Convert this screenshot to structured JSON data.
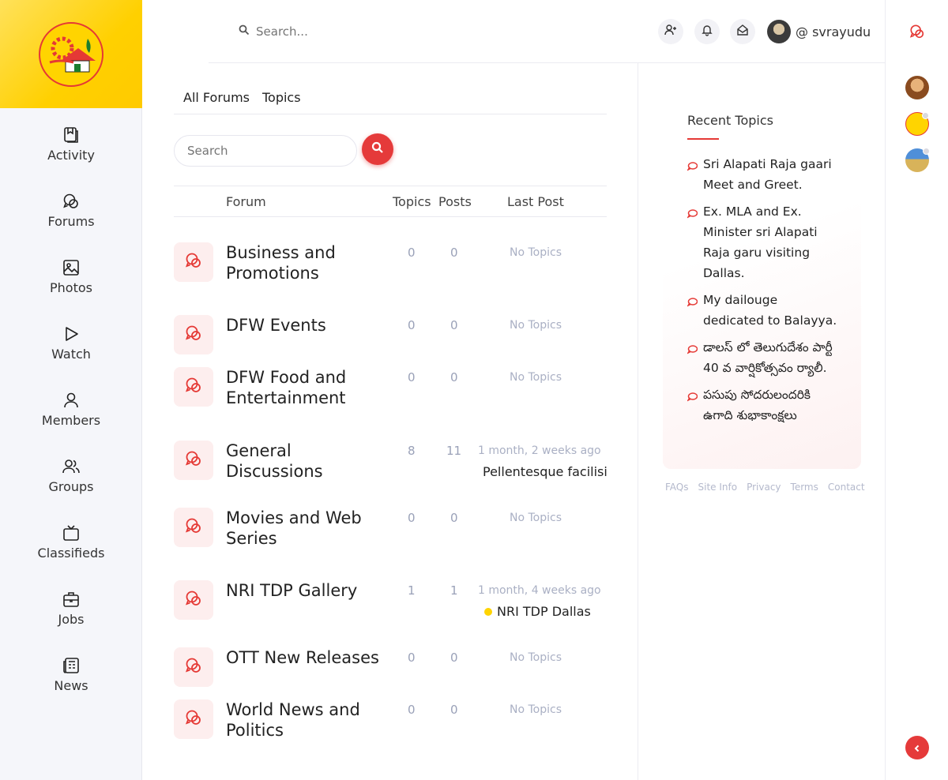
{
  "header": {
    "search_placeholder": "Search...",
    "username": "@ svrayudu"
  },
  "sidebar": {
    "items": [
      {
        "label": "Activity",
        "icon": "activity-icon"
      },
      {
        "label": "Forums",
        "icon": "forums-icon"
      },
      {
        "label": "Photos",
        "icon": "photos-icon"
      },
      {
        "label": "Watch",
        "icon": "watch-icon"
      },
      {
        "label": "Members",
        "icon": "members-icon"
      },
      {
        "label": "Groups",
        "icon": "groups-icon"
      },
      {
        "label": "Classifieds",
        "icon": "classifieds-icon"
      },
      {
        "label": "Jobs",
        "icon": "jobs-icon"
      },
      {
        "label": "News",
        "icon": "news-icon"
      }
    ]
  },
  "main": {
    "tabs": [
      "All Forums",
      "Topics"
    ],
    "search_placeholder": "Search",
    "columns": {
      "forum": "Forum",
      "topics": "Topics",
      "posts": "Posts",
      "last_post": "Last Post"
    },
    "forums": [
      {
        "name": "Business and Promotions",
        "topics": "0",
        "posts": "0",
        "last": "No Topics",
        "last_by": ""
      },
      {
        "name": "DFW Events",
        "topics": "0",
        "posts": "0",
        "last": "No Topics",
        "last_by": ""
      },
      {
        "name": "DFW Food and Entertainment",
        "topics": "0",
        "posts": "0",
        "last": "No Topics",
        "last_by": ""
      },
      {
        "name": "General Discussions",
        "topics": "8",
        "posts": "11",
        "last": "1 month, 2 weeks ago",
        "last_by": "Pellentesque facilisis"
      },
      {
        "name": "Movies and Web Series",
        "topics": "0",
        "posts": "0",
        "last": "No Topics",
        "last_by": ""
      },
      {
        "name": "NRI TDP Gallery",
        "topics": "1",
        "posts": "1",
        "last": "1 month, 4 weeks ago",
        "last_by": "NRI TDP Dallas"
      },
      {
        "name": "OTT New Releases",
        "topics": "0",
        "posts": "0",
        "last": "No Topics",
        "last_by": ""
      },
      {
        "name": "World News and Politics",
        "topics": "0",
        "posts": "0",
        "last": "No Topics",
        "last_by": ""
      }
    ]
  },
  "widget": {
    "title": "Recent Topics",
    "topics": [
      "Sri Alapati Raja gaari Meet and Greet.",
      "Ex. MLA and Ex. Minister sri Alapati Raja garu visiting Dallas.",
      "My dailouge dedicated to Balayya.",
      "డాలస్ లో తెలుగుదేశం పార్టీ 40 వ వార్షికోత్సవం ర్యాలీ.",
      "పసుపు సోదరులందరికి ఉగాది శుభాకాంక్షలు"
    ]
  },
  "footer": [
    "FAQs",
    "Site Info",
    "Privacy",
    "Terms",
    "Contact"
  ],
  "colors": {
    "accent": "#e53a3a",
    "brand_yellow": "#ffd000"
  }
}
